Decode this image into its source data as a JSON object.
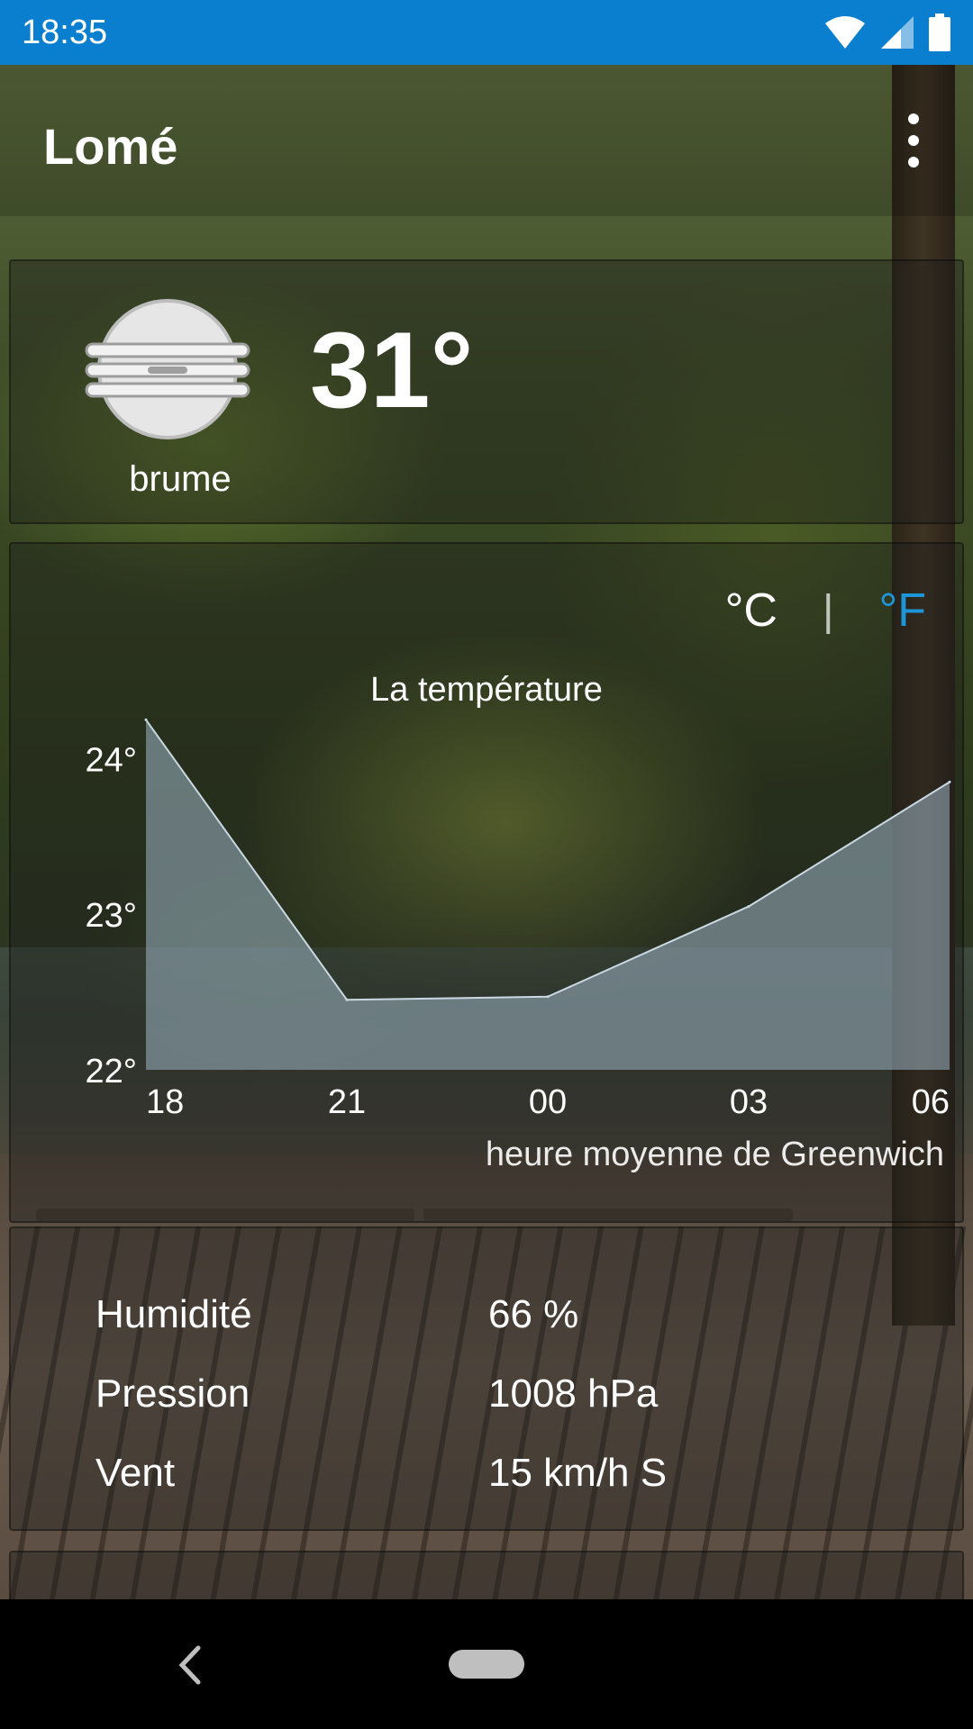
{
  "status_bar": {
    "time": "18:35",
    "icons": [
      "wifi-icon",
      "cell-signal-icon",
      "battery-icon"
    ]
  },
  "app_bar": {
    "city": "Lomé",
    "menu_icon": "more-vert-icon"
  },
  "current": {
    "temperature": "31°",
    "condition": "brume",
    "icon": "mist-icon"
  },
  "units": {
    "celsius": "°C",
    "separator": "|",
    "fahrenheit": "°F",
    "active_color": "#1e95d8"
  },
  "chart_data": {
    "type": "area",
    "title": "La température",
    "x": [
      "18",
      "21",
      "00",
      "03",
      "06"
    ],
    "values": [
      24.25,
      22.45,
      22.47,
      23.05,
      23.85
    ],
    "y_ticks": [
      "24°",
      "23°",
      "22°"
    ],
    "ylim": [
      22,
      24.35
    ],
    "xlabel": "heure moyenne de Greenwich",
    "fill_color": "#9fb7c7"
  },
  "details": [
    {
      "label": "Humidité",
      "value": "66 %"
    },
    {
      "label": "Pression",
      "value": "1008 hPa"
    },
    {
      "label": "Vent",
      "value": "15 km/h S"
    }
  ],
  "nav_bar": {
    "back_icon": "back-icon",
    "home_icon": "home-pill-icon"
  }
}
